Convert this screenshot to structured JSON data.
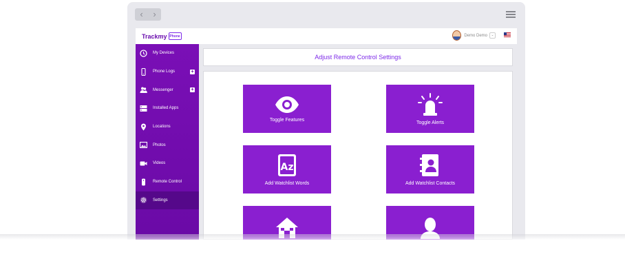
{
  "browser": {
    "back_glyph": "‹",
    "forward_glyph": "›"
  },
  "header": {
    "logo_text": "Trackmy",
    "logo_badge": "Phone",
    "user_name": "Demo Demo",
    "caret": "⌄"
  },
  "sidebar": {
    "items": [
      {
        "label": "My Devices",
        "icon": "clock-icon",
        "expandable": false
      },
      {
        "label": "Phone Logs",
        "icon": "phone-icon",
        "expandable": true
      },
      {
        "label": "Messenger",
        "icon": "chat-users-icon",
        "expandable": true
      },
      {
        "label": "Installed Apps",
        "icon": "apps-list-icon",
        "expandable": false
      },
      {
        "label": "Locations",
        "icon": "map-pin-icon",
        "expandable": false
      },
      {
        "label": "Photos",
        "icon": "image-icon",
        "expandable": false
      },
      {
        "label": "Videos",
        "icon": "video-camera-icon",
        "expandable": false
      },
      {
        "label": "Remote Control",
        "icon": "remote-icon",
        "expandable": false
      },
      {
        "label": "Settings",
        "icon": "gear-icon",
        "expandable": false,
        "active": true
      }
    ],
    "plus_glyph": "+"
  },
  "main": {
    "title": "Adjust Remote Control Settings",
    "tiles": [
      {
        "label": "Toggle Features",
        "icon": "eye-icon"
      },
      {
        "label": "Toggle Alerts",
        "icon": "siren-icon"
      },
      {
        "label": "Add Watchlist Words",
        "icon": "az-dictionary-icon"
      },
      {
        "label": "Add Watchlist Contacts",
        "icon": "contact-book-icon"
      },
      {
        "label": "",
        "icon": "home-icon"
      },
      {
        "label": "",
        "icon": "user-silhouette-icon"
      }
    ]
  },
  "colors": {
    "sidebar": "#7a0fb6",
    "sidebar_active": "#55088a",
    "tile": "#8a1fd0",
    "title_text": "#7d2ae8"
  }
}
